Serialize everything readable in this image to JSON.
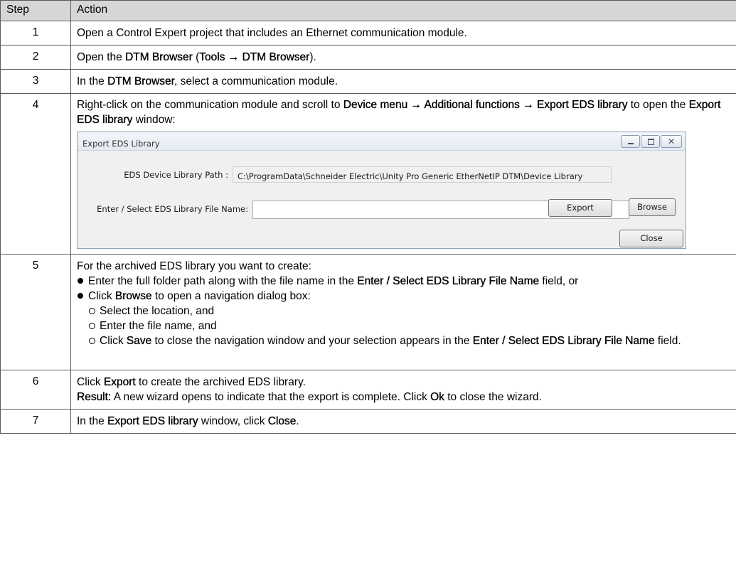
{
  "headers": {
    "step": "Step",
    "action": "Action"
  },
  "rows": [
    {
      "step": "1",
      "text": "Open a Control Expert project that includes an Ethernet communication module."
    },
    {
      "step": "2",
      "p1": "Open the ",
      "b1": "DTM Browser",
      "p2": " (",
      "b2": "Tools → DTM Browser",
      "p3": ")."
    },
    {
      "step": "3",
      "p1": "In the ",
      "b1": "DTM Browser",
      "p2": ", select a communication module."
    },
    {
      "step": "4",
      "p1": "Right-click on the communication module and scroll to ",
      "b1": "Device menu → Additional functions → Export EDS library",
      "p2": " to open the ",
      "b2": "Export EDS library",
      "p3": " window:"
    },
    {
      "step": "5",
      "intro": "For the archived EDS library you want to create:",
      "b1_p1": "Enter the full folder path along with the file name in the ",
      "b1_b1": "Enter / Select EDS Library File Name",
      "b1_p2": " field, or",
      "b2_p1": "Click ",
      "b2_b1": "Browse",
      "b2_p2": " to open a navigation dialog box:",
      "s1": "Select the location, and",
      "s2": "Enter the file name, and",
      "s3_p1": "Click ",
      "s3_b1": "Save",
      "s3_p2": " to close the navigation window and your selection appears in the ",
      "s3_b2": "Enter / Select EDS Library File Name",
      "s3_p3": " field."
    },
    {
      "step": "6",
      "p1": "Click ",
      "b1": "Export",
      "p2": " to create the archived EDS library.",
      "r_b": "Result:",
      "r_p1": " A new wizard opens to indicate that the export is complete. Click ",
      "r_b2": "Ok",
      "r_p2": " to close the wizard."
    },
    {
      "step": "7",
      "p1": "In the ",
      "b1": "Export EDS library",
      "p2": " window, click ",
      "b2": "Close",
      "p3": "."
    }
  ],
  "dialog": {
    "title": "Export EDS Library",
    "close_glyph": "✕",
    "path_label": "EDS Device Library Path :",
    "path_value": "C:\\ProgramData\\Schneider Electric\\Unity Pro Generic EtherNetIP DTM\\Device Library",
    "file_label": "Enter / Select EDS Library File Name:",
    "file_value": "",
    "browse": "Browse",
    "export": "Export",
    "close": "Close"
  }
}
